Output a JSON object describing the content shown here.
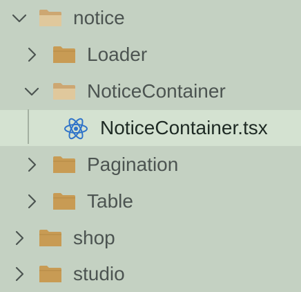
{
  "tree": {
    "notice": {
      "label": "notice",
      "icon": "folder-open-icon",
      "expanded": true
    },
    "loader": {
      "label": "Loader",
      "icon": "folder-closed-icon",
      "expanded": false
    },
    "notice_container": {
      "label": "NoticeContainer",
      "icon": "folder-open-icon",
      "expanded": true
    },
    "notice_container_file": {
      "label": "NoticeContainer.tsx",
      "icon": "react-icon",
      "selected": true
    },
    "pagination": {
      "label": "Pagination",
      "icon": "folder-closed-icon",
      "expanded": false
    },
    "table": {
      "label": "Table",
      "icon": "folder-closed-icon",
      "expanded": false
    },
    "shop": {
      "label": "shop",
      "icon": "folder-closed-icon",
      "expanded": false
    },
    "studio": {
      "label": "studio",
      "icon": "folder-closed-icon",
      "expanded": false
    }
  },
  "colors": {
    "background": "#c4d1c2",
    "selected_row": "#d4e2d1",
    "folder_closed": "#c89b54",
    "folder_open": "#dcbf8e",
    "react_icon": "#2f73c9",
    "text": "#4c5451"
  }
}
